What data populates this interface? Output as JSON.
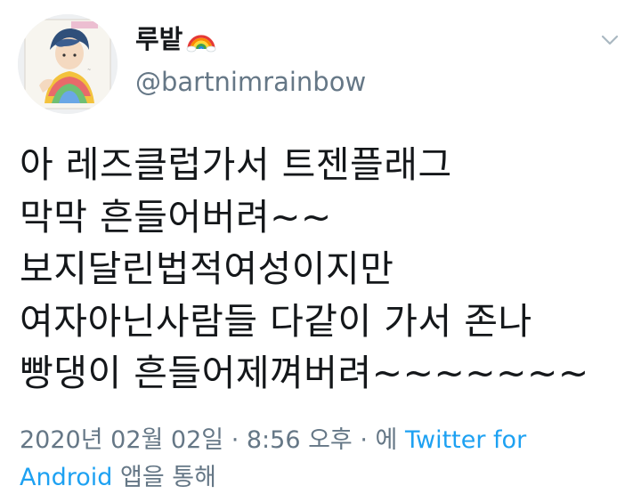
{
  "user": {
    "display_name": "루밭",
    "handle": "@bartnimrainbow",
    "badge_icon": "rainbow-icon"
  },
  "tweet": {
    "lines": [
      "아 레즈클럽가서 트젠플래그",
      "막막 흔들어버려~~",
      "보지달린법적여성이지만",
      "여자아닌사람들 다같이 가서 존나",
      "빵댕이 흔들어제껴버려~~~~~~~"
    ]
  },
  "meta": {
    "date": "2020년 02월 02일",
    "sep1": " · ",
    "time": "8:56 오후",
    "sep2": " · ",
    "via_prefix": "에 ",
    "source": "Twitter for Android",
    "suffix": " 앱을 통해"
  },
  "colors": {
    "text": "#14171a",
    "secondary": "#657786",
    "link": "#1da1f2"
  },
  "icons": {
    "caret": "chevron-down-icon"
  }
}
